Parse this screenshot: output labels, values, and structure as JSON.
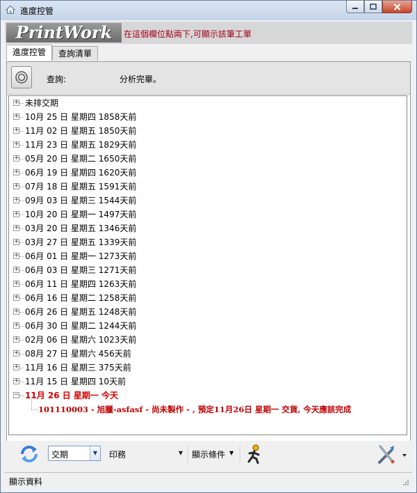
{
  "window": {
    "title": "進度控管"
  },
  "banner": {
    "logo": "PrintWork",
    "hint": "在這個欄位點兩下,可顯示該筆工單"
  },
  "tabs": [
    {
      "label": "進度控管",
      "active": true
    },
    {
      "label": "查詢清單",
      "active": false
    }
  ],
  "query": {
    "label": "查詢:",
    "status": "分析完畢。"
  },
  "tree": {
    "items": [
      "未排交期",
      "10月 25 日 星期四 1858天前",
      "11月 02 日 星期五 1850天前",
      "11月 23 日 星期五 1829天前",
      "05月 20 日 星期二 1650天前",
      "06月 19 日 星期四 1620天前",
      "07月 18 日 星期五 1591天前",
      "09月 03 日 星期三 1544天前",
      "10月 20 日 星期一 1497天前",
      "03月 20 日 星期五 1346天前",
      "03月 27 日 星期五 1339天前",
      "06月 01 日 星期一 1273天前",
      "06月 03 日 星期三 1271天前",
      "06月 11 日 星期四 1263天前",
      "06月 16 日 星期二 1258天前",
      "06月 26 日 星期五 1248天前",
      "06月 30 日 星期二 1244天前",
      "02月 06 日 星期六 1023天前",
      "08月 27 日 星期六 456天前",
      "11月 16 日 星期三 375天前",
      "11月 15 日 星期四 10天前"
    ],
    "today": {
      "label": "11月 26 日 星期一 今天",
      "child": "101110003 - 旭臘-asfasf - 尚未製作 - , 預定11月26日 星期一 交貨, 今天應該完成"
    }
  },
  "toolbar": {
    "combo_value": "交期",
    "print_label": "印務",
    "print_value": "",
    "filter_label": "顯示條件"
  },
  "status": {
    "text": "顯示資料"
  },
  "colors": {
    "today": "#d40000",
    "hint": "#a0001c"
  }
}
